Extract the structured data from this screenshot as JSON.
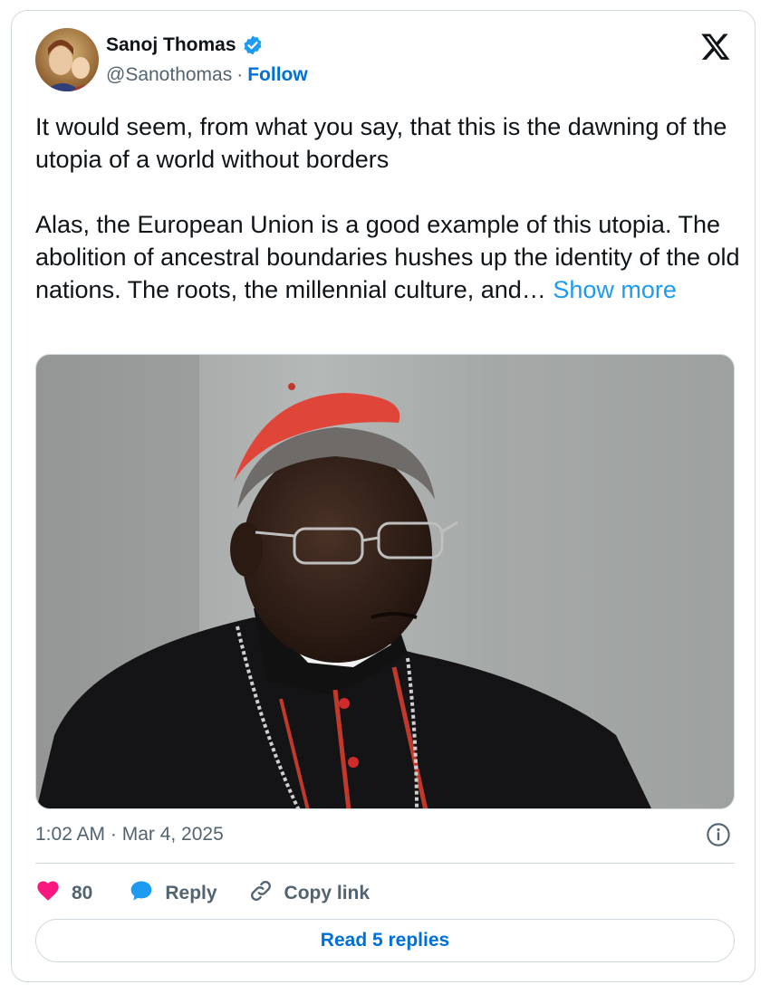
{
  "author": {
    "name": "Sanoj Thomas",
    "handle": "@Sanothomas",
    "separator": "·",
    "follow_label": "Follow"
  },
  "tweet": {
    "paragraph1": "It would seem, from what you say, that this is the dawning of the utopia of a world without borders",
    "paragraph2": "Alas, the European Union is a good example of this utopia. The abolition of ancestral boundaries hushes up the identity of the old nations. The roots, the millennial culture, and…",
    "show_more_label": "Show more"
  },
  "meta": {
    "timestamp": "1:02 AM · Mar 4, 2025"
  },
  "actions": {
    "like_count": "80",
    "reply_label": "Reply",
    "copy_link_label": "Copy link",
    "read_replies_label": "Read 5 replies"
  },
  "colors": {
    "accent_blue": "#1d9bf0",
    "link_blue": "#006fd6",
    "like_pink": "#f91880",
    "muted_text": "#536471",
    "border": "#cfd9de"
  },
  "icons": {
    "logo": "x-logo-icon",
    "verified": "verified-badge-icon",
    "info": "info-icon",
    "like": "heart-icon",
    "reply": "speech-bubble-icon",
    "copy": "link-icon"
  }
}
